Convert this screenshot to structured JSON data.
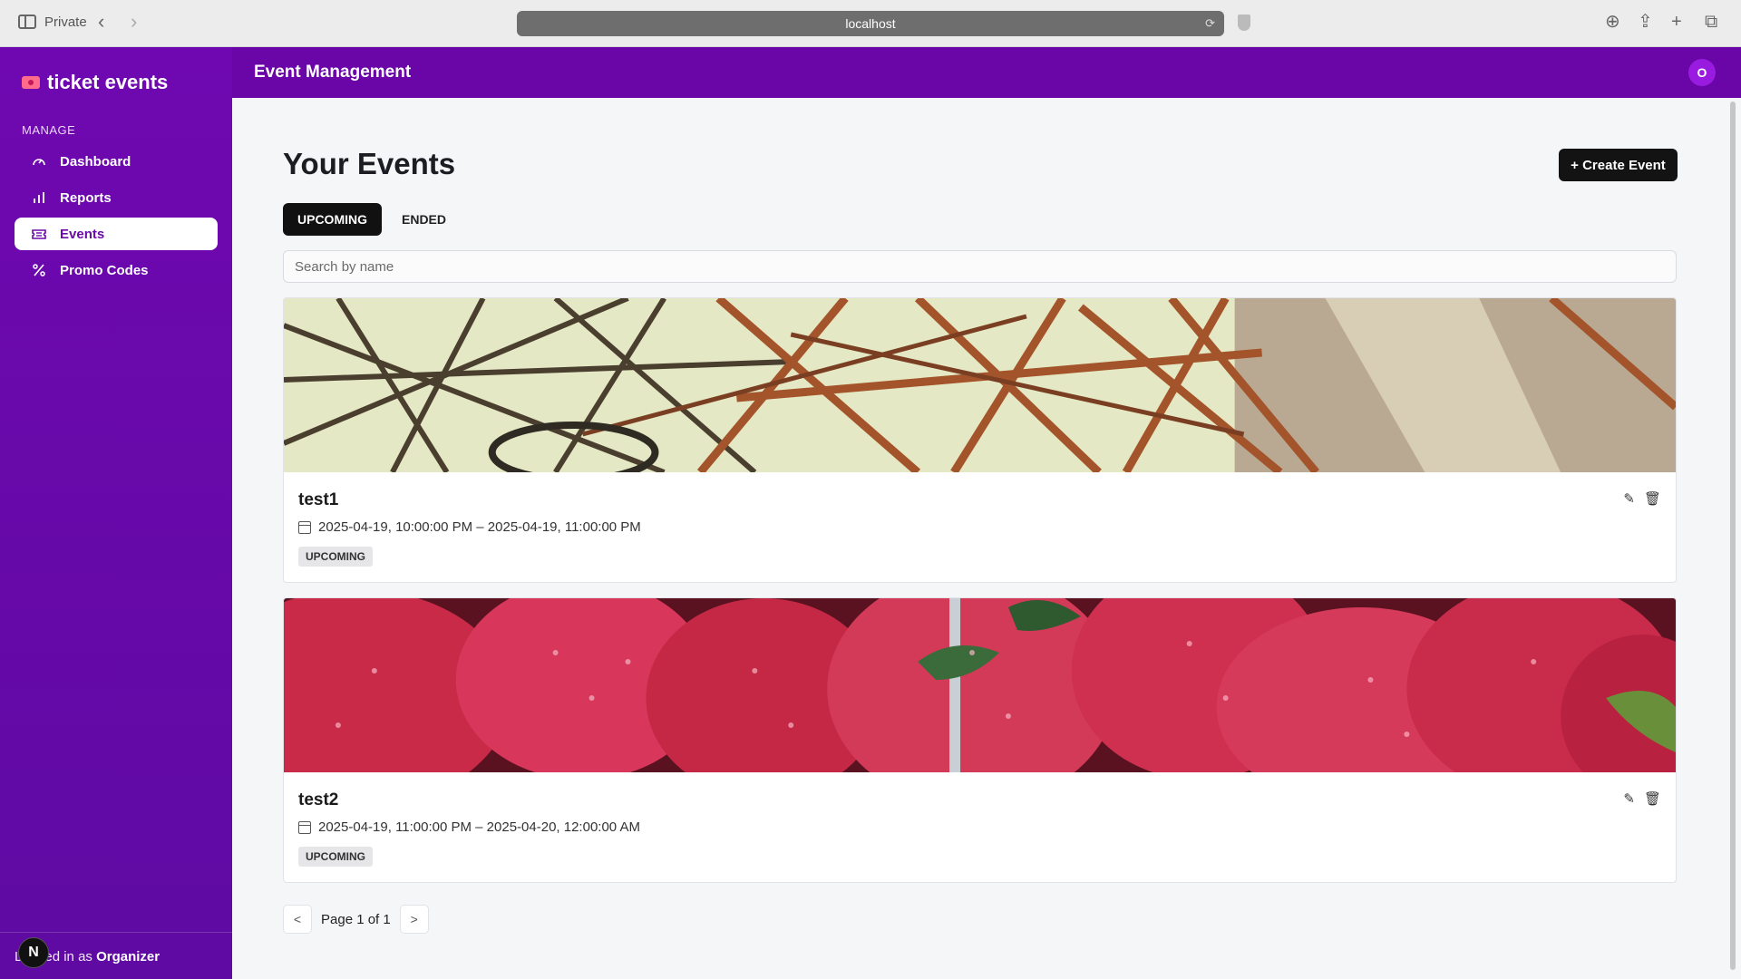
{
  "browser": {
    "private_label": "Private",
    "url": "localhost"
  },
  "sidebar": {
    "brand": "ticket events",
    "section": "MANAGE",
    "items": [
      {
        "label": "Dashboard",
        "icon": "gauge-icon"
      },
      {
        "label": "Reports",
        "icon": "bar-chart-icon"
      },
      {
        "label": "Events",
        "icon": "ticket-icon",
        "active": true
      },
      {
        "label": "Promo Codes",
        "icon": "percent-icon"
      }
    ],
    "logged_prefix": "Logged in as ",
    "logged_user": "Organizer",
    "badge": "N"
  },
  "topbar": {
    "title": "Event Management",
    "avatar_initial": "O"
  },
  "main": {
    "title": "Your Events",
    "create_button": "+ Create Event",
    "tabs": [
      {
        "label": "UPCOMING",
        "active": true
      },
      {
        "label": "ENDED",
        "active": false
      }
    ],
    "search_placeholder": "Search by name",
    "events": [
      {
        "name": "test1",
        "dates": "2025-04-19, 10:00:00 PM – 2025-04-19, 11:00:00 PM",
        "status": "UPCOMING"
      },
      {
        "name": "test2",
        "dates": "2025-04-19, 11:00:00 PM – 2025-04-20, 12:00:00 AM",
        "status": "UPCOMING"
      }
    ],
    "pager": {
      "prev": "<",
      "text": "Page 1 of 1",
      "next": ">"
    }
  },
  "colors": {
    "sidebar": "#6f08b0",
    "topbar": "#6a05a8",
    "primary_button": "#131313"
  }
}
